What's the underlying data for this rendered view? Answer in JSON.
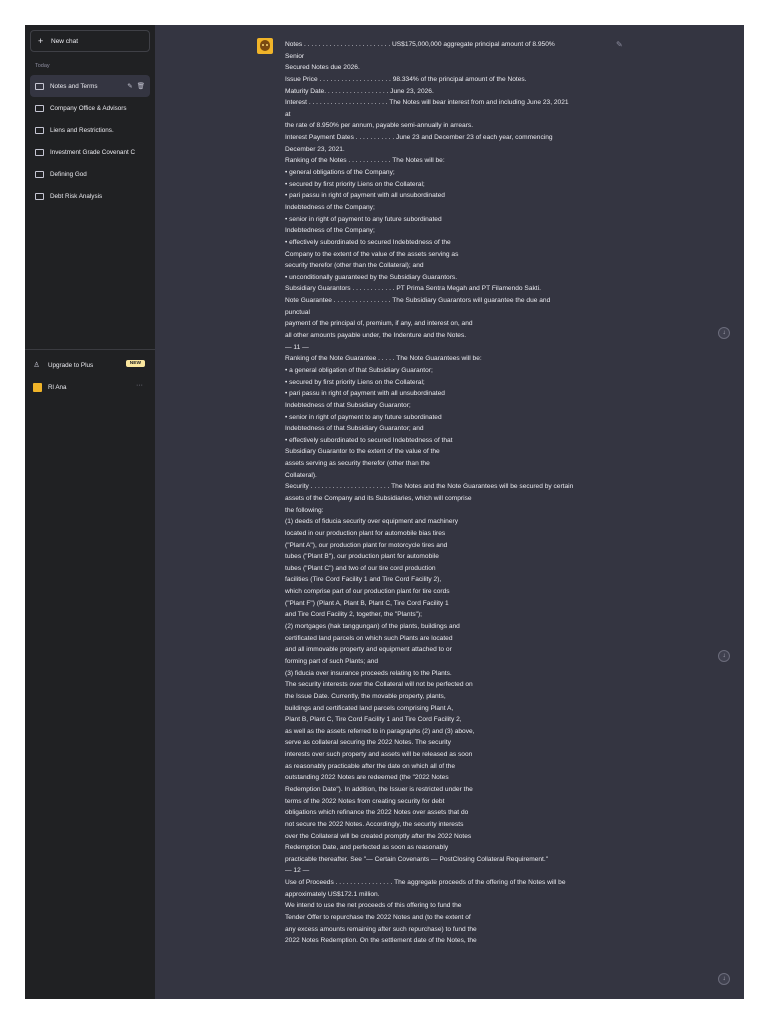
{
  "sidebar": {
    "new_chat_label": "New chat",
    "section_label": "Today",
    "items": [
      {
        "label": "Notes and Terms"
      },
      {
        "label": "Company Office & Advisors"
      },
      {
        "label": "Liens and Restrictions."
      },
      {
        "label": "Investment Grade Covenant C"
      },
      {
        "label": "Defining God"
      },
      {
        "label": "Debt Risk Analysis"
      }
    ],
    "upgrade_label": "Upgrade to Plus",
    "upgrade_badge": "NEW",
    "user_name": "Rl Ana"
  },
  "message": {
    "lines": [
      "Notes . . . . . . . . . . . . . . . . . . . . . . . . US$175,000,000 aggregate principal amount of 8.950%",
      "Senior",
      "Secured Notes due 2026.",
      "Issue Price . . . . . . . . . . . . . . . . . . . . 98.334% of the principal amount of the Notes.",
      "Maturity Date. . . . . . . . . . . . . . . . . . June 23, 2026.",
      "Interest . . . . . . . . . . . . . . . . . . . . . . The Notes will bear interest from and including June 23, 2021",
      "at",
      "the rate of 8.950% per annum, payable semi-annually in arrears.",
      "Interest Payment Dates . . . . . . . . . . . June 23 and December 23 of each year, commencing",
      "December 23, 2021.",
      "Ranking of the Notes . . . . . . . . . . . . The Notes will be:",
      "• general obligations of the Company;",
      "• secured by first priority Liens on the Collateral;",
      "• pari passu in right of payment with all unsubordinated",
      "Indebtedness of the Company;",
      "• senior in right of payment to any future subordinated",
      "Indebtedness of the Company;",
      "• effectively subordinated to secured Indebtedness of the",
      "Company to the extent of the value of the assets serving as",
      "security therefor (other than the Collateral); and",
      "• unconditionally guaranteed by the Subsidiary Guarantors.",
      "Subsidiary Guarantors . . . . . . . . . . . . PT Prima Sentra Megah and PT Filamendo Sakti.",
      "Note Guarantee . . . . . . . . . . . . . . . . The Subsidiary Guarantors will guarantee the due and",
      "punctual",
      "payment of the principal of, premium, if any, and interest on, and",
      "all other amounts payable under, the Indenture and the Notes.",
      "— 11 —",
      "Ranking of the Note Guarantee . . . . . The Note Guarantees will be:",
      "• a general obligation of that Subsidiary Guarantor;",
      "• secured by first priority Liens on the Collateral;",
      "• pari passu in right of payment with all unsubordinated",
      "Indebtedness of that Subsidiary Guarantor;",
      "• senior in right of payment to any future subordinated",
      "Indebtedness of that Subsidiary Guarantor; and",
      "• effectively subordinated to secured Indebtedness of that",
      "Subsidiary Guarantor to the extent of the value of the",
      "assets serving as security therefor (other than the",
      "Collateral).",
      "Security . . . . . . . . . . . . . . . . . . . . . . The Notes and the Note Guarantees will be secured by certain",
      "assets of the Company and its Subsidiaries, which will comprise",
      "the following:",
      "(1) deeds of fiducia security over equipment and machinery",
      "located in our production plant for automobile bias tires",
      "(\"Plant A\"), our production plant for motorcycle tires and",
      "tubes (\"Plant B\"), our production plant for automobile",
      "tubes (\"Plant C\") and two of our tire cord production",
      "facilities (Tire Cord Facility 1 and Tire Cord Facility 2),",
      "which comprise part of our production plant for tire cords",
      "(\"Plant F\") (Plant A, Plant B, Plant C, Tire Cord Facility 1",
      "and Tire Cord Facility 2, together, the \"Plants\");",
      "(2) mortgages (hak tanggungan) of the plants, buildings and",
      "certificated land parcels on which such Plants are located",
      "and all immovable property and equipment attached to or",
      "forming part of such Plants; and",
      "(3) fiducia over insurance proceeds relating to the Plants.",
      "The security interests over the Collateral will not be perfected on",
      "the Issue Date. Currently, the movable property, plants,",
      "buildings and certificated land parcels comprising Plant A,",
      "Plant B, Plant C, Tire Cord Facility 1 and Tire Cord Facility 2,",
      "as well as the assets referred to in paragraphs (2) and (3) above,",
      "serve as collateral securing the 2022 Notes. The security",
      "interests over such property and assets will be released as soon",
      "as reasonably practicable after the date on which all of the",
      "outstanding 2022 Notes are redeemed (the \"2022 Notes",
      "Redemption Date\"). In addition, the Issuer is restricted under the",
      "terms of the 2022 Notes from creating security for debt",
      "obligations which refinance the 2022 Notes over assets that do",
      "not secure the 2022 Notes. Accordingly, the security interests",
      "over the Collateral will be created promptly after the 2022 Notes",
      "Redemption Date, and perfected as soon as reasonably",
      "practicable thereafter. See \"— Certain Covenants — PostClosing Collateral Requirement.\"",
      "— 12 —",
      "Use of Proceeds . . . . . . . . . . . . . . . . The aggregate proceeds of the offering of the Notes will be",
      "approximately US$172.1 million.",
      "We intend to use the net proceeds of this offering to fund the",
      "Tender Offer to repurchase the 2022 Notes and (to the extent of",
      "any excess amounts remaining after such repurchase) to fund the",
      "2022 Notes Redemption. On the settlement date of the Notes, the"
    ]
  }
}
